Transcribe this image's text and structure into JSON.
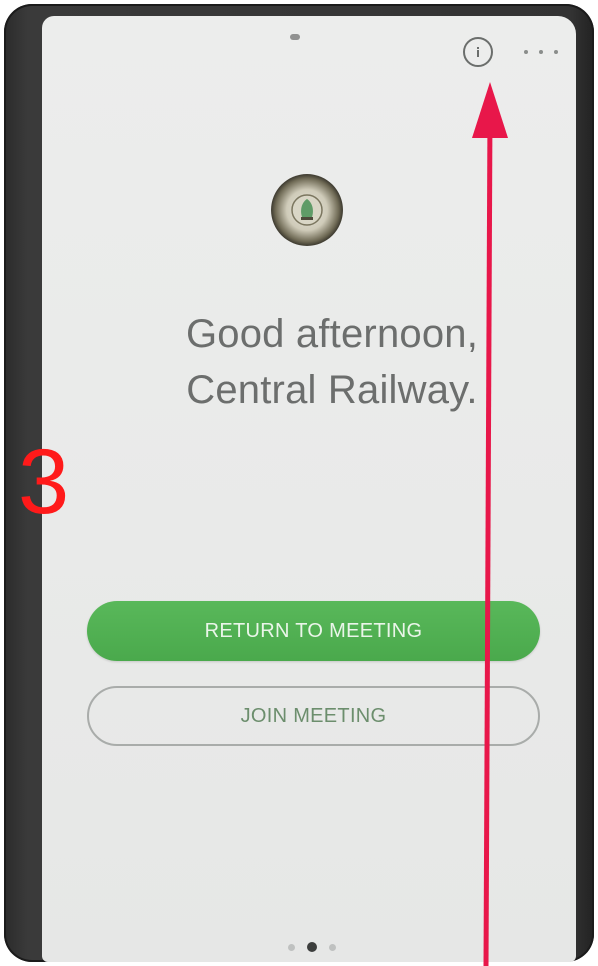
{
  "header": {
    "info_icon": "info-circle-icon",
    "more_icon": "more-horizontal-icon"
  },
  "logo": {
    "icon": "organization-emblem-icon"
  },
  "greeting": {
    "line1": "Good afternoon,",
    "line2": "Central Railway."
  },
  "actions": {
    "return_label": "RETURN TO MEETING",
    "join_label": "JOIN MEETING"
  },
  "pager": {
    "count": 3,
    "active_index": 1
  },
  "annotation": {
    "step_number": "3",
    "color": "#ff1a1a",
    "arrow_color": "#e8174a"
  },
  "colors": {
    "accent_green": "#4caf50",
    "text_gray": "#6c6e6d",
    "screen_bg": "#ebeceb"
  }
}
